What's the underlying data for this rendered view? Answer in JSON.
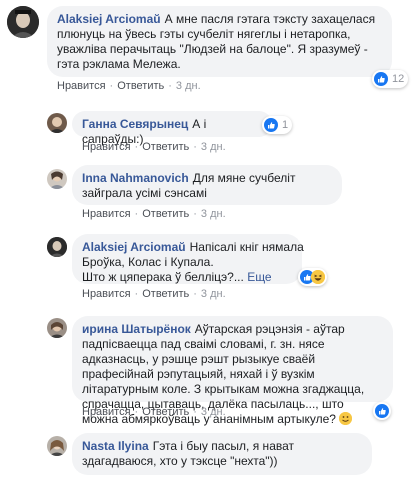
{
  "comments": [
    {
      "author": "Alaksiej Arciomaŭ",
      "text": "А мне пасля гэтага тэксту захацелася плюнуць на ўвесь гэты сучбеліт нягеглы і нетаропка, уважліва перачытаць \"Людзей на балоце\". Я зразумеў - гэта рэклама Мележа.",
      "actions": [
        "Нравится",
        "Ответить"
      ],
      "time": "3 дн.",
      "reactions": {
        "icons": [
          "like-icon"
        ],
        "count": "12"
      }
    },
    {
      "author": "Ганна Севярынец",
      "text": "А і сапраўды:)",
      "actions": [
        "Нравится",
        "Ответить"
      ],
      "time": "3 дн.",
      "reactions": {
        "icons": [
          "like-icon"
        ],
        "count": "1"
      }
    },
    {
      "author": "Inna Nahmanovich",
      "text": "Для мяне сучбеліт зайграла усімі сэнсамі",
      "actions": [
        "Нравится",
        "Ответить"
      ],
      "time": "3 дн."
    },
    {
      "author": "Alaksiej Arciomaŭ",
      "text_lines": [
        "Напісалі кніг нямала",
        "Броўка, Колас і Купала.",
        "Што ж цяперака ў белліцэ?..."
      ],
      "more": "Еще",
      "actions": [
        "Нравится",
        "Ответить"
      ],
      "time": "3 дн.",
      "reactions": {
        "icons": [
          "like-icon",
          "haha-icon"
        ],
        "count": ""
      }
    },
    {
      "author": "ирина Шатырёнок",
      "text": "Аўтарская рэцэнзія - аўтар падпісваецца пад сваімі словамі, г. зн. нясе адказнасць, у рэшце рэшт рызыкуе сваёй прафесійнай рэпутацыяй, няхай і ў вузкім літаратурным коле. З крытыкам можна згаджацца, спрачацца, цытаваць, далёка пасылаць..., што можна абмяркоўваць у ананімным артыкуле?",
      "actions": [
        "Нравится",
        "Ответить"
      ],
      "time": "3 дн.",
      "reactions": {
        "icons": [
          "like-icon"
        ],
        "count": ""
      }
    },
    {
      "author": "Nasta Ilyina",
      "text": "Гэта і быу пасыл, я нават здагадваюся, хто у тэксце \"нехта\"))",
      "actions": [],
      "time": ""
    }
  ],
  "colors": {
    "author": "#385898",
    "bubble": "#f2f3f5",
    "like": "#1877f2",
    "meta": "#90949c"
  }
}
